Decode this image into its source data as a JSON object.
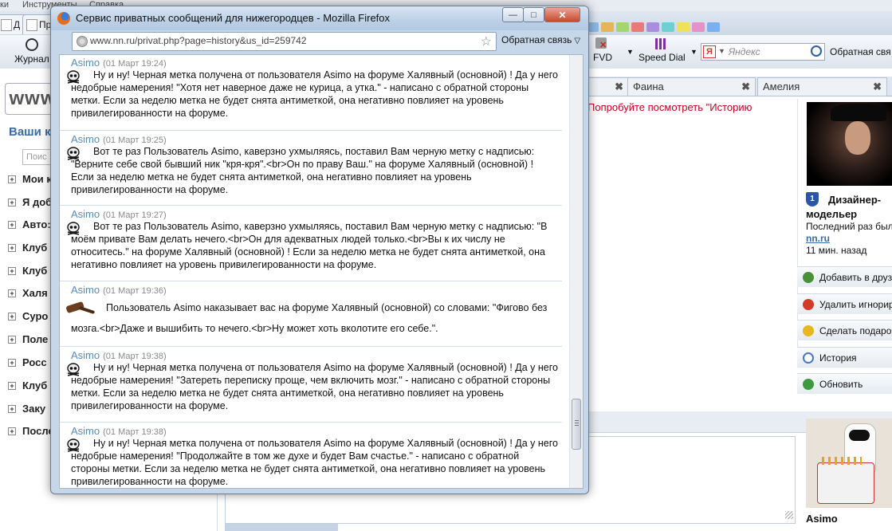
{
  "background": {
    "menubar": [
      "ки",
      "Инструменты",
      "Справка"
    ],
    "tabs": [
      {
        "label": "Д"
      },
      {
        "label": "Пр"
      }
    ],
    "nav": {
      "journal_label": "Журнал",
      "fvd_label": "FVD",
      "speed_dial_label": "Speed Dial",
      "search_placeholder": "Яндекс",
      "feedback_label": "Обратная свя"
    },
    "left": {
      "logo_text": "www",
      "heading": "Ваши к",
      "search_placeholder": "Поис",
      "items": [
        "Мои к",
        "Я доб",
        "Авто:",
        "Клуб",
        "Клуб",
        "Халя",
        "Суро",
        "Поле",
        "Росс",
        "Клуб",
        "Заку",
        "После"
      ]
    },
    "contact_tabs": [
      {
        "label": ""
      },
      {
        "label": "Фаина"
      },
      {
        "label": "Амелия"
      }
    ],
    "history_hint": "Попробуйте посмотреть \"Историю",
    "profile": {
      "name": "Дизайнер-модельер",
      "last_visit": "Последний раз был",
      "site": "nn.ru",
      "minutes_ago": "11 мин. назад"
    },
    "actions": [
      {
        "label": "Добавить в друз",
        "icon": "add-friend-icon",
        "color": "#4a8f3a"
      },
      {
        "label": "Удалить игнорир",
        "icon": "remove-ignore-icon",
        "color": "#d43a2a"
      },
      {
        "label": "Сделать подарок",
        "icon": "gift-icon",
        "color": "#e8b620"
      },
      {
        "label": "История",
        "icon": "history-icon",
        "color": "#4a78c0"
      },
      {
        "label": "Обновить",
        "icon": "refresh-icon",
        "color": "#3e9a3e"
      }
    ],
    "bottom_profile_name": "Asimo"
  },
  "popup": {
    "title": "Сервис приватных сообщений для нижегородцев - Mozilla Firefox",
    "buttons": {
      "minimize": "—",
      "maximize": "□",
      "close": "✕"
    },
    "url": "www.nn.ru/privat.php?page=history&us_id=259742",
    "feedback_label": "Обратная связь",
    "messages": [
      {
        "author": "Asimo",
        "date": "(01 Март 19:24)",
        "icon": "skull-icon",
        "text": "Ну и ну! Черная метка получена от пользователя Asimo на форуме Халявный (основной) ! Да у него недобрые намерения! \"Хотя нет наверное даже не курица, а утка.\" - написано с обратной стороны метки. Если за неделю метка не будет снята антиметкой, она негативно повлияет на уровень привилегированности на форуме."
      },
      {
        "author": "Asimo",
        "date": "(01 Март 19:25)",
        "icon": "skull-icon",
        "text": "Вот те раз Пользователь Asimo, каверзно ухмыляясь, поставил Вам черную метку с надписью: \"Верните себе свой бывший ник \"кря-кря\".<br>Он по праву Ваш.\" на форуме Халявный (основной) ! Если за неделю метка не будет снята антиметкой, она негативно повлияет на уровень привилегированности на форуме."
      },
      {
        "author": "Asimo",
        "date": "(01 Март 19:27)",
        "icon": "skull-icon",
        "text": "Вот те раз Пользователь Asimo, каверзно ухмыляясь, поставил Вам черную метку с надписью: \"В моём привате Вам делать нечего.<br>Он для адекватных людей только.<br>Вы к их числу не относитесь.\" на форуме Халявный (основной) ! Если за неделю метка не будет снята антиметкой, она негативно повлияет на уровень привилегированности на форуме."
      },
      {
        "author": "Asimo",
        "date": "(01 Март 19:36)",
        "icon": "gavel-icon",
        "text": "Пользователь Asimo наказывает вас на форуме Халявный (основной) со словами: \"Фигово без мозга.<br>Даже и вышибить то нечего.<br>Ну может хоть вколотите его себе.\"."
      },
      {
        "author": "Asimo",
        "date": "(01 Март 19:38)",
        "icon": "skull-icon",
        "text": "Ну и ну! Черная метка получена от пользователя Asimo на форуме Халявный (основной) ! Да у него недобрые намерения! \"Затереть переписку проще, чем включить мозг.\" - написано с обратной стороны метки. Если за неделю метка не будет снята антиметкой, она негативно повлияет на уровень привилегированности на форуме."
      },
      {
        "author": "Asimo",
        "date": "(01 Март 19:38)",
        "icon": "skull-icon",
        "text": "Ну и ну! Черная метка получена от пользователя Asimo на форуме Халявный (основной) ! Да у него недобрые намерения! \"Продолжайте в том же духе и будет Вам счастье.\" - написано с обратной стороны метки. Если за неделю метка не будет снята антиметкой, она негативно повлияет на уровень привилегированности на форуме."
      }
    ]
  }
}
